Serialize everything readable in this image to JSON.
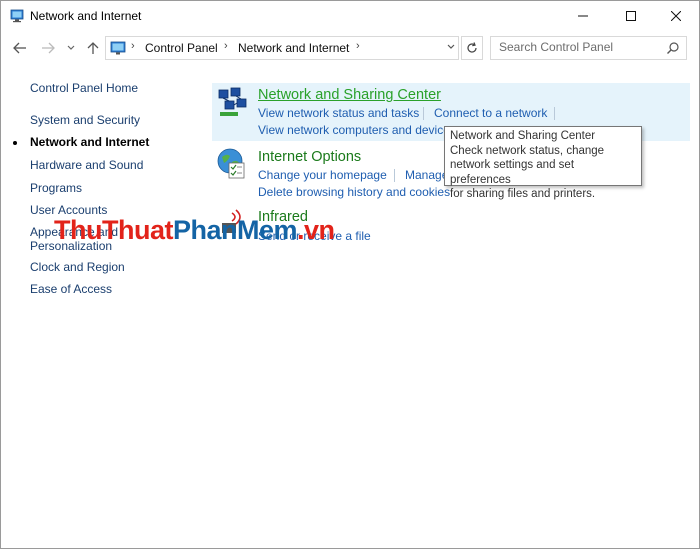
{
  "window": {
    "title": "Network and Internet",
    "buttons": {
      "minimize": "—",
      "maximize": "☐",
      "close": "✕"
    }
  },
  "address_bar": {
    "crumbs": [
      "Control Panel",
      "Network and Internet"
    ],
    "separator": "›",
    "dropdown": "⌄",
    "refresh": "↻"
  },
  "search": {
    "placeholder": "Search Control Panel"
  },
  "sidebar": {
    "home": "Control Panel Home",
    "items": [
      {
        "label": "System and Security",
        "active": false
      },
      {
        "label": "Network and Internet",
        "active": true
      },
      {
        "label": "Hardware and Sound",
        "active": false
      },
      {
        "label": "Programs",
        "active": false
      },
      {
        "label": "User Accounts",
        "active": false
      },
      {
        "label": "Appearance and",
        "active": false
      },
      {
        "label": "Personalization",
        "active": false
      },
      {
        "label": "Clock and Region",
        "active": false
      },
      {
        "label": "Ease of Access",
        "active": false
      }
    ]
  },
  "categories": [
    {
      "title": "Network and Sharing Center",
      "icon": "network-sharing-icon",
      "tasks": [
        "View network status and tasks",
        "Connect to a network",
        "View network computers and devices"
      ]
    },
    {
      "title": "Internet Options",
      "icon": "internet-options-icon",
      "tasks": [
        "Change your homepage",
        "Manage browser add-ons",
        "Delete browsing history and cookies"
      ]
    },
    {
      "title": "Infrared",
      "icon": "infrared-icon",
      "tasks": [
        "Send or receive a file"
      ]
    }
  ],
  "tooltip": {
    "lines": [
      "Network and Sharing Center",
      "Check network status, change",
      "network settings and set preferences",
      "for sharing files and printers."
    ]
  },
  "watermark": {
    "part1": "ThuThuat",
    "part2": "PhanMem",
    "part3": ".vn"
  },
  "colors": {
    "link": "#1f5eb0",
    "category_title": "#1b7a1b",
    "highlight": "#e5f3fb"
  }
}
